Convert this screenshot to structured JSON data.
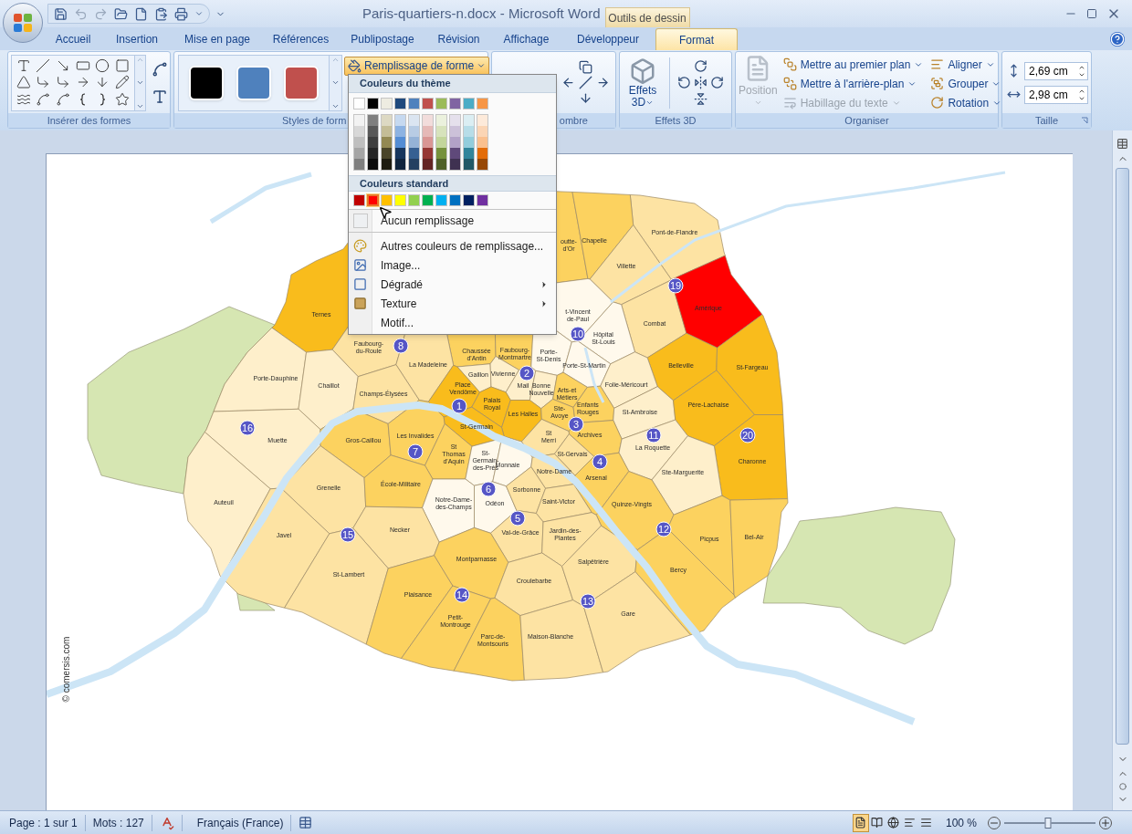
{
  "window": {
    "title": "Paris-quartiers-n.docx - Microsoft Word",
    "contextual_header": "Outils de dessin"
  },
  "ribbon_tabs": [
    {
      "label": "Accueil",
      "selected": false
    },
    {
      "label": "Insertion",
      "selected": false
    },
    {
      "label": "Mise en page",
      "selected": false
    },
    {
      "label": "Références",
      "selected": false
    },
    {
      "label": "Publipostage",
      "selected": false
    },
    {
      "label": "Révision",
      "selected": false
    },
    {
      "label": "Affichage",
      "selected": false
    },
    {
      "label": "Développeur",
      "selected": false
    },
    {
      "label": "Format",
      "selected": true
    }
  ],
  "ribbon": {
    "insert_shapes": {
      "label": "Insérer des formes"
    },
    "shape_styles": {
      "label": "Styles de form",
      "swatches": [
        {
          "color": "#000000"
        },
        {
          "color": "#4f81bd"
        },
        {
          "color": "#c0504d"
        }
      ],
      "fill_button": {
        "label": "Remplissage de forme",
        "open": true
      }
    },
    "shadow": {
      "label": "ombre"
    },
    "effects_3d": {
      "label": "Effets 3D",
      "button": "Effets 3D"
    },
    "arrange": {
      "label": "Organiser",
      "position": {
        "label": "Position",
        "disabled": true
      },
      "commands": [
        {
          "label": "Mettre au premier plan",
          "disabled": false
        },
        {
          "label": "Mettre à l'arrière-plan",
          "disabled": false
        },
        {
          "label": "Habillage du texte",
          "disabled": true
        },
        {
          "label": "Aligner",
          "disabled": false
        },
        {
          "label": "Grouper",
          "disabled": false
        },
        {
          "label": "Rotation",
          "disabled": false
        }
      ]
    },
    "size": {
      "label": "Taille",
      "height": "2,69 cm",
      "width": "2,98 cm"
    }
  },
  "fill_menu": {
    "theme_header": "Couleurs du thème",
    "theme_colors": [
      {
        "color": "#ffffff",
        "shades": [
          {
            "color": "#f2f2f2"
          },
          {
            "color": "#d8d8d8"
          },
          {
            "color": "#bfbfbf"
          },
          {
            "color": "#a5a5a5"
          },
          {
            "color": "#7f7f7f"
          }
        ]
      },
      {
        "color": "#000000",
        "shades": [
          {
            "color": "#7f7f7f"
          },
          {
            "color": "#595959"
          },
          {
            "color": "#3f3f3f"
          },
          {
            "color": "#262626"
          },
          {
            "color": "#0c0c0c"
          }
        ]
      },
      {
        "color": "#eeece1",
        "shades": [
          {
            "color": "#ddd9c3"
          },
          {
            "color": "#c4bd97"
          },
          {
            "color": "#938953"
          },
          {
            "color": "#494429"
          },
          {
            "color": "#1d1b10"
          }
        ]
      },
      {
        "color": "#1f497d",
        "shades": [
          {
            "color": "#c6d9f0"
          },
          {
            "color": "#8db3e2"
          },
          {
            "color": "#548dd4"
          },
          {
            "color": "#17365d"
          },
          {
            "color": "#0f243e"
          }
        ]
      },
      {
        "color": "#4f81bd",
        "shades": [
          {
            "color": "#dbe5f1"
          },
          {
            "color": "#b8cce4"
          },
          {
            "color": "#95b3d7"
          },
          {
            "color": "#366092"
          },
          {
            "color": "#244061"
          }
        ]
      },
      {
        "color": "#c0504d",
        "shades": [
          {
            "color": "#f2dcdb"
          },
          {
            "color": "#e5b9b7"
          },
          {
            "color": "#d99694"
          },
          {
            "color": "#953734"
          },
          {
            "color": "#632423"
          }
        ]
      },
      {
        "color": "#9bbb59",
        "shades": [
          {
            "color": "#ebf1dd"
          },
          {
            "color": "#d7e3bc"
          },
          {
            "color": "#c3d69b"
          },
          {
            "color": "#76923c"
          },
          {
            "color": "#4f6128"
          }
        ]
      },
      {
        "color": "#8064a2",
        "shades": [
          {
            "color": "#e5e0ec"
          },
          {
            "color": "#ccc1d9"
          },
          {
            "color": "#b2a2c7"
          },
          {
            "color": "#5f497a"
          },
          {
            "color": "#3f3151"
          }
        ]
      },
      {
        "color": "#4bacc6",
        "shades": [
          {
            "color": "#dbeef3"
          },
          {
            "color": "#b7dde8"
          },
          {
            "color": "#92cddc"
          },
          {
            "color": "#31859b"
          },
          {
            "color": "#205867"
          }
        ]
      },
      {
        "color": "#f79646",
        "shades": [
          {
            "color": "#fdeada"
          },
          {
            "color": "#fbd5b5"
          },
          {
            "color": "#fac08f"
          },
          {
            "color": "#e36c09"
          },
          {
            "color": "#974806"
          }
        ]
      }
    ],
    "standard_header": "Couleurs standard",
    "standard_colors": [
      {
        "color": "#c00000",
        "selected": false
      },
      {
        "color": "#ff0000",
        "selected": true
      },
      {
        "color": "#ffc000",
        "selected": false
      },
      {
        "color": "#ffff00",
        "selected": false
      },
      {
        "color": "#92d050",
        "selected": false
      },
      {
        "color": "#00b050",
        "selected": false
      },
      {
        "color": "#00b0f0",
        "selected": false
      },
      {
        "color": "#0070c0",
        "selected": false
      },
      {
        "color": "#002060",
        "selected": false
      },
      {
        "color": "#7030a0",
        "selected": false
      }
    ],
    "no_fill": "Aucun remplissage",
    "items": [
      {
        "label": "Autres couleurs de remplissage...",
        "submenu": false
      },
      {
        "label": "Image...",
        "submenu": false
      },
      {
        "label": "Dégradé",
        "submenu": true
      },
      {
        "label": "Texture",
        "submenu": true
      },
      {
        "label": "Motif...",
        "submenu": false
      }
    ]
  },
  "map": {
    "credit": "© comersis.com",
    "quartiers": [
      {
        "name": "Pont-de-Flandre",
        "color": "#fde3a3"
      },
      {
        "name": "outte-\nd'Or",
        "color": "#fcd25f"
      },
      {
        "name": "Chapelle",
        "color": "#fcd25f"
      },
      {
        "name": "Villette",
        "color": "#fde3a3"
      },
      {
        "name": "Ternes",
        "color": "#f9bc1c"
      },
      {
        "name": "t-Vincent\nde-Paul",
        "color": "#fff9ec"
      },
      {
        "name": "Combat",
        "color": "#fde3a3"
      },
      {
        "name": "Amérique",
        "color": "#ff0000"
      },
      {
        "name": "Faubourg-\ndu-Roule",
        "color": "#fde3a3"
      },
      {
        "name": "Chaussée\nd'Antin",
        "color": "#fcd25f"
      },
      {
        "name": "Faubourg-\nMontmartre",
        "color": "#fcd25f"
      },
      {
        "name": "Porte-\nSt-Denis",
        "color": "#fff9ec"
      },
      {
        "name": "Hôpital\nSt-Louis",
        "color": "#fff9ec"
      },
      {
        "name": "La Madeleine",
        "color": "#fde3a3"
      },
      {
        "name": "Porte-St-Martin",
        "color": "#fff9ec"
      },
      {
        "name": "Belleville",
        "color": "#f9bc1c"
      },
      {
        "name": "St-Fargeau",
        "color": "#f9bc1c"
      },
      {
        "name": "Porte-Dauphine",
        "color": "#feefcb"
      },
      {
        "name": "Gaillon",
        "color": "#feefcb"
      },
      {
        "name": "Vivienne",
        "color": "#feefcb"
      },
      {
        "name": "Chaillot",
        "color": "#feefcb"
      },
      {
        "name": "Champs-Élysées",
        "color": "#fde3a3"
      },
      {
        "name": "Place\nVendôme",
        "color": "#f9bc1c"
      },
      {
        "name": "Mail",
        "color": "#feefcb"
      },
      {
        "name": "Bonne\nNouvelle",
        "color": "#feefcb"
      },
      {
        "name": "Arts-et\nMétiers",
        "color": "#fcd25f"
      },
      {
        "name": "Folie-Méricourt",
        "color": "#feefcb"
      },
      {
        "name": "Palais\nRoyal",
        "color": "#f9bc1c"
      },
      {
        "name": "Les Halles",
        "color": "#f9bc1c"
      },
      {
        "name": "Ste-\nAvoye",
        "color": "#fcd25f"
      },
      {
        "name": "Enfants\nRouges",
        "color": "#fcd25f"
      },
      {
        "name": "St-Ambroise",
        "color": "#feefcb"
      },
      {
        "name": "Père-Lachaise",
        "color": "#f9bc1c"
      },
      {
        "name": "Muette",
        "color": "#feefcb"
      },
      {
        "name": "Gros-Caillou",
        "color": "#fcd25f"
      },
      {
        "name": "Les Invalides",
        "color": "#fcd25f"
      },
      {
        "name": "St-Germain",
        "color": "#f9bc1c"
      },
      {
        "name": "St\nMerri",
        "color": "#fde3a3"
      },
      {
        "name": "Archives",
        "color": "#fcd25f"
      },
      {
        "name": "St\nThomas\nd'Aquin",
        "color": "#fcd25f"
      },
      {
        "name": "St-\nGermain-\ndes-Prés",
        "color": "#fff9ec"
      },
      {
        "name": "St-Gervais",
        "color": "#fde3a3"
      },
      {
        "name": "La Roquette",
        "color": "#feefcb"
      },
      {
        "name": "Charonne",
        "color": "#f9bc1c"
      },
      {
        "name": "Monnaie",
        "color": "#fff9ec"
      },
      {
        "name": "Notre-Dame",
        "color": "#fde3a3"
      },
      {
        "name": "Arsenal",
        "color": "#fcd25f"
      },
      {
        "name": "Ste-Marguerite",
        "color": "#feefcb"
      },
      {
        "name": "Auteuil",
        "color": "#feefcb"
      },
      {
        "name": "Grenelle",
        "color": "#fde3a3"
      },
      {
        "name": "École-Militaire",
        "color": "#fcd25f"
      },
      {
        "name": "Notre-Dame-\ndes-Champs",
        "color": "#fff9ec"
      },
      {
        "name": "Odéon",
        "color": "#fff9ec"
      },
      {
        "name": "Sorbonne",
        "color": "#fde3a3"
      },
      {
        "name": "Saint-Victor",
        "color": "#fde3a3"
      },
      {
        "name": "Quinze-Vingts",
        "color": "#fcd25f"
      },
      {
        "name": "Javel",
        "color": "#fde3a3"
      },
      {
        "name": "Necker",
        "color": "#fde3a3"
      },
      {
        "name": "Val-de-Grâce",
        "color": "#fde3a3"
      },
      {
        "name": "Jardin-des-\nPlantes",
        "color": "#fde3a3"
      },
      {
        "name": "Picpus",
        "color": "#fcd25f"
      },
      {
        "name": "Bel-Air",
        "color": "#fcd25f"
      },
      {
        "name": "St-Lambert",
        "color": "#fde3a3"
      },
      {
        "name": "Montparnasse",
        "color": "#fcd25f"
      },
      {
        "name": "Croulebarbe",
        "color": "#fde3a3"
      },
      {
        "name": "Salpêtrière",
        "color": "#fde3a3"
      },
      {
        "name": "Bercy",
        "color": "#fcd25f"
      },
      {
        "name": "Plaisance",
        "color": "#fcd25f"
      },
      {
        "name": "Petit-\nMontrouge",
        "color": "#fcd25f"
      },
      {
        "name": "Parc-de-\nMontsouris",
        "color": "#fcd25f"
      },
      {
        "name": "Maison-Blanche",
        "color": "#fde3a3"
      },
      {
        "name": "Gare",
        "color": "#fde3a3"
      }
    ],
    "arrondissements": [
      "1",
      "2",
      "3",
      "4",
      "5",
      "6",
      "7",
      "8",
      "10",
      "11",
      "12",
      "13",
      "14",
      "15",
      "16",
      "19",
      "20"
    ]
  },
  "status_bar": {
    "page": "Page : 1 sur 1",
    "words": "Mots : 127",
    "language": "Français (France)",
    "views": [
      {
        "selected": true
      },
      {
        "selected": false
      },
      {
        "selected": false
      },
      {
        "selected": false
      },
      {
        "selected": false
      }
    ],
    "zoom": {
      "label": "100 %",
      "level": 0.48
    }
  }
}
